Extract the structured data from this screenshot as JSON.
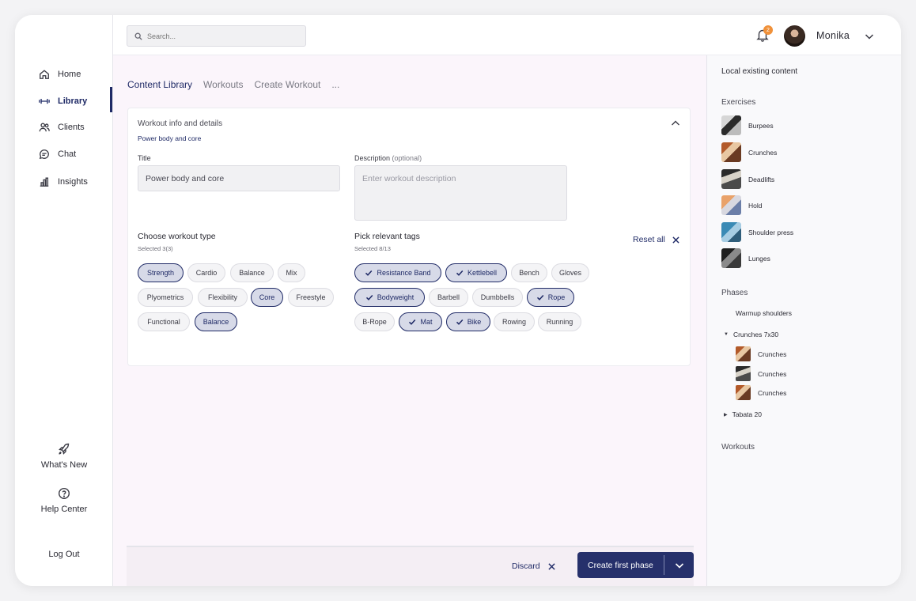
{
  "sidebar": {
    "nav": [
      {
        "label": "Home",
        "icon": "home-icon"
      },
      {
        "label": "Library",
        "icon": "dumbbell-icon"
      },
      {
        "label": "Clients",
        "icon": "users-icon"
      },
      {
        "label": "Chat",
        "icon": "chat-icon"
      },
      {
        "label": "Insights",
        "icon": "chart-icon"
      }
    ],
    "active": "Library",
    "whats_new": "What's New",
    "help_center": "Help Center",
    "logout": "Log Out"
  },
  "topbar": {
    "search_placeholder": "Search...",
    "notification_count": "2",
    "username": "Monika"
  },
  "breadcrumb": [
    "Content Library",
    "Workouts",
    "Create Workout",
    "..."
  ],
  "card": {
    "title": "Workout info and details",
    "subtitle": "Power body and core",
    "title_label": "Title",
    "title_value": "Power body and core",
    "description_label": "Description",
    "description_optional": "(optional)",
    "description_placeholder": "Enter workout description",
    "workout_type_title": "Choose workout type",
    "workout_type_selected": "Selected 3(3)",
    "tags_title": "Pick relevant tags",
    "tags_selected": "Selected 8/13",
    "reset_label": "Reset all",
    "workout_types": [
      {
        "label": "Strength",
        "selected": true
      },
      {
        "label": "Cardio",
        "selected": false
      },
      {
        "label": "Balance",
        "selected": false
      },
      {
        "label": "Mix",
        "selected": false
      },
      {
        "label": "Plyometrics",
        "selected": false
      },
      {
        "label": "Flexibility",
        "selected": false
      },
      {
        "label": "Core",
        "selected": true
      },
      {
        "label": "Freestyle",
        "selected": false
      },
      {
        "label": "Functional",
        "selected": false
      },
      {
        "label": "Balance",
        "selected": true
      }
    ],
    "tags": [
      {
        "label": "Resistance Band",
        "selected": true
      },
      {
        "label": "Kettlebell",
        "selected": true
      },
      {
        "label": "Bench",
        "selected": false
      },
      {
        "label": "Gloves",
        "selected": false
      },
      {
        "label": "Bodyweight",
        "selected": true
      },
      {
        "label": "Barbell",
        "selected": false
      },
      {
        "label": "Dumbbells",
        "selected": false
      },
      {
        "label": "Rope",
        "selected": true
      },
      {
        "label": "B-Rope",
        "selected": false
      },
      {
        "label": "Mat",
        "selected": true
      },
      {
        "label": "Bike",
        "selected": true
      },
      {
        "label": "Rowing",
        "selected": false
      },
      {
        "label": "Running",
        "selected": false
      }
    ]
  },
  "footer": {
    "discard": "Discard",
    "primary": "Create first phase"
  },
  "right_panel": {
    "title": "Local existing content",
    "exercises_heading": "Exercises",
    "exercises": [
      "Burpees",
      "Crunches",
      "Deadlifts",
      "Hold",
      "Shoulder press",
      "Lunges"
    ],
    "phases_heading": "Phases",
    "phases": {
      "warmup": "Warmup shoulders",
      "group": "Crunches 7x30",
      "group_items": [
        "Crunches",
        "Crunches",
        "Crunches"
      ],
      "tabata": "Tabata 20"
    },
    "workouts_heading": "Workouts"
  },
  "colors": {
    "accent": "#1f2a66",
    "badge": "#f0913a",
    "selected_chip_bg": "#d7dae8",
    "main_bg": "#fbf5fb"
  }
}
